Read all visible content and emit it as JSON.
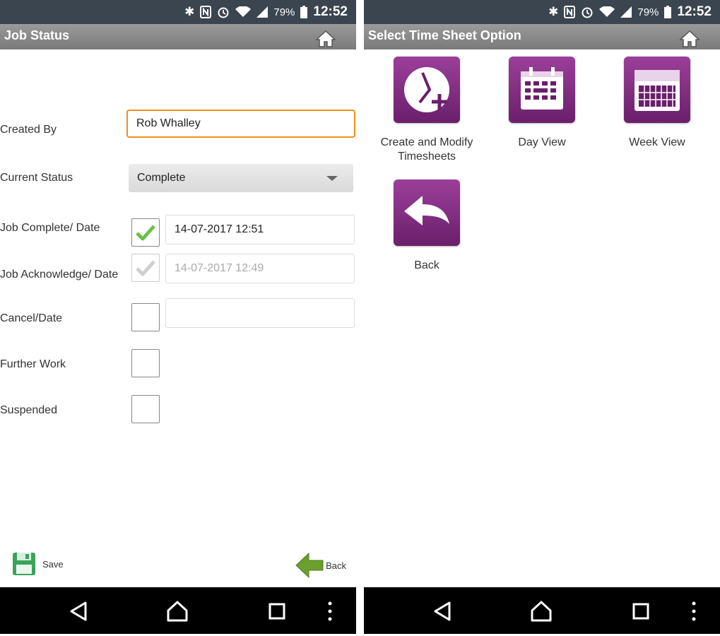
{
  "status_bar": {
    "battery": "79%",
    "time": "12:52"
  },
  "job_status": {
    "title": "Job Status",
    "created_by": {
      "label": "Created By",
      "value": "Rob Whalley"
    },
    "current_status": {
      "label": "Current Status",
      "value": "Complete"
    },
    "job_complete": {
      "label": "Job Complete/ Date",
      "checked": true,
      "date": "14-07-2017 12:51"
    },
    "job_acknowledge": {
      "label": "Job Acknowledge/ Date",
      "checked": true,
      "disabled": true,
      "date": "14-07-2017 12:49"
    },
    "cancel": {
      "label": "Cancel/Date",
      "checked": false,
      "date": ""
    },
    "further_work": {
      "label": "Further Work",
      "checked": false
    },
    "suspended": {
      "label": "Suspended",
      "checked": false
    },
    "save_label": "Save",
    "back_label": "Back"
  },
  "time_sheet": {
    "title": "Select Time Sheet Option",
    "tiles": [
      {
        "label": "Create and Modify Timesheets"
      },
      {
        "label": "Day View"
      },
      {
        "label": "Week View"
      },
      {
        "label": "Back"
      }
    ]
  },
  "colors": {
    "accent": "#f0901a",
    "tile": "#7b2a7c",
    "check": "#6cc04a",
    "save_green": "#3aa35a",
    "back_green": "#6b9f2e"
  }
}
